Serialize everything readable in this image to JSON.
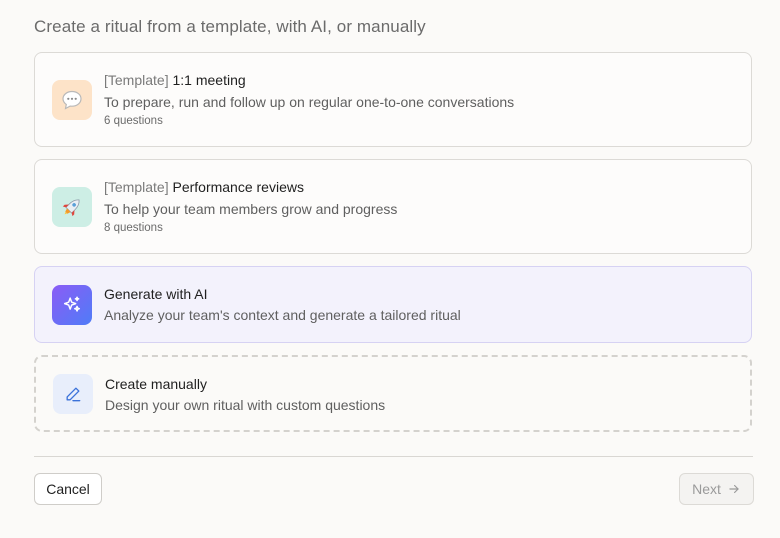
{
  "heading": "Create a ritual from a template, with AI, or manually",
  "options": [
    {
      "prefix": "[Template]",
      "title": "1:1 meeting",
      "description": "To prepare, run and follow up on regular one-to-one conversations",
      "count": "6 questions",
      "icon": "speech-bubble-icon",
      "icon_bg": "#fde3c8"
    },
    {
      "prefix": "[Template]",
      "title": "Performance reviews",
      "description": "To help your team members grow and progress",
      "count": "8 questions",
      "icon": "rocket-icon",
      "icon_bg": "#cdeee5"
    },
    {
      "title": "Generate with AI",
      "description": "Analyze your team's context and generate a tailored ritual",
      "icon": "sparkles-icon",
      "icon_bg": "#6d5cf0"
    },
    {
      "title": "Create manually",
      "description": "Design your own ritual with custom questions",
      "icon": "pen-icon",
      "icon_bg": "#e8eefb"
    }
  ],
  "footer": {
    "cancel_label": "Cancel",
    "next_label": "Next"
  }
}
